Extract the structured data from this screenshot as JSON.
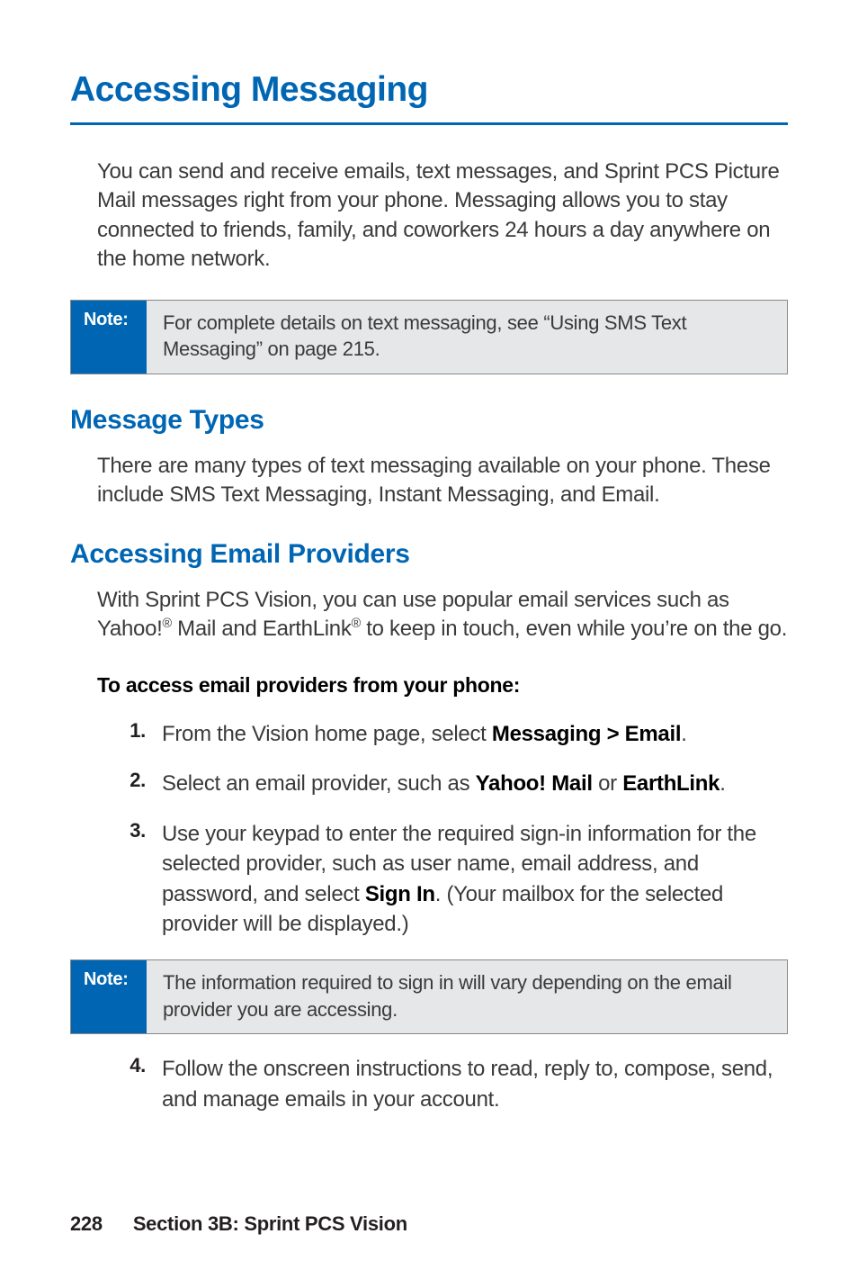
{
  "title": "Accessing Messaging",
  "intro": "You can send and receive emails, text messages, and Sprint PCS Picture Mail messages right from your phone. Messaging allows you to stay connected to friends, family, and coworkers 24 hours a day anywhere on the home network.",
  "note1": {
    "label": "Note:",
    "text": "For complete details on text messaging, see “Using SMS Text Messaging” on page 215."
  },
  "sec1": {
    "heading": "Message Types",
    "body": "There are many types of text messaging available on your phone. These include SMS Text Messaging, Instant Messaging, and Email."
  },
  "sec2": {
    "heading": "Accessing Email Providers",
    "intro_pre": "With Sprint PCS Vision, you can use popular email services such as Yahoo!",
    "intro_mid": " Mail and EarthLink",
    "intro_post": " to keep in touch, even while you’re on the go.",
    "lead": "To access email providers from your phone:",
    "steps": {
      "s1": {
        "num": "1.",
        "pre": "From the Vision home page, select ",
        "b1": "Messaging > Email",
        "post": "."
      },
      "s2": {
        "num": "2.",
        "pre": "Select an email provider, such as ",
        "b1": "Yahoo! Mail",
        "mid": " or ",
        "b2": "EarthLink",
        "post": "."
      },
      "s3": {
        "num": "3.",
        "pre": "Use your keypad to enter the required sign-in information for the selected provider, such as user name, email address, and password, and select ",
        "b1": "Sign In",
        "post": ". (Your mailbox for the selected provider will be displayed.)"
      },
      "s4": {
        "num": "4.",
        "text": "Follow the onscreen instructions to read, reply to, compose, send, and manage emails in your account."
      }
    }
  },
  "note2": {
    "label": "Note:",
    "text": "The information required to sign in will vary depending on the email provider you are accessing."
  },
  "footer": {
    "page": "228",
    "section": "Section 3B: Sprint PCS Vision"
  }
}
